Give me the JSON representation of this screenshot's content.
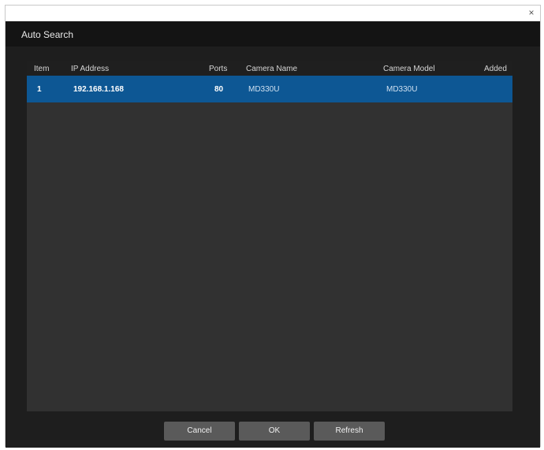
{
  "window": {
    "close_glyph": "×",
    "title": "Auto Search"
  },
  "table": {
    "columns": {
      "item": "Item",
      "ip": "IP Address",
      "ports": "Ports",
      "camera_name": "Camera Name",
      "camera_model": "Camera Model",
      "added": "Added"
    },
    "rows": [
      {
        "item": "1",
        "ip": "192.168.1.168",
        "ports": "80",
        "camera_name": "MD330U",
        "camera_model": "MD330U",
        "added": "",
        "selected": true
      }
    ]
  },
  "buttons": {
    "cancel": "Cancel",
    "ok": "OK",
    "refresh": "Refresh"
  },
  "colors": {
    "selection": "#0d5794",
    "panel": "#313131",
    "header": "#141414",
    "button": "#5a5a5a"
  }
}
